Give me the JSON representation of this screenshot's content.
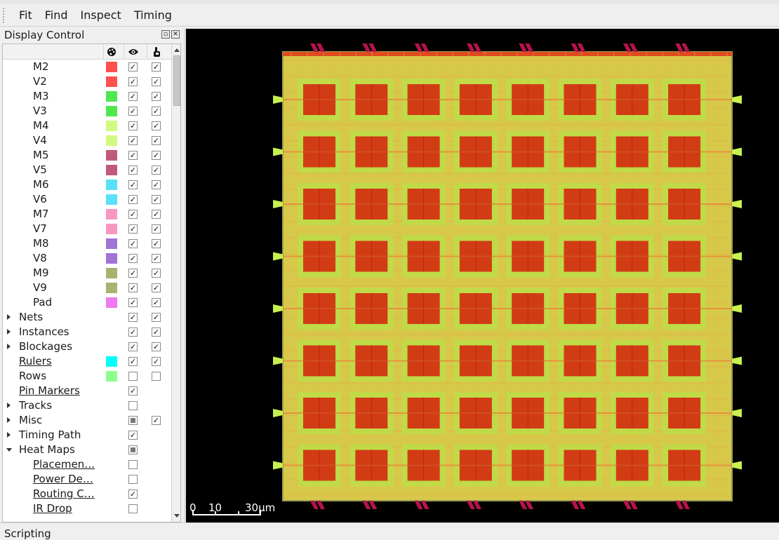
{
  "menu": [
    "Fit",
    "Find",
    "Inspect",
    "Timing"
  ],
  "dock": {
    "title": "Display Control",
    "float_icon": "float-icon",
    "close_icon": "close-icon",
    "columns": [
      "palette-icon",
      "eye-icon",
      "pointer-hand-icon"
    ],
    "rows": [
      {
        "label": "M2",
        "level": 2,
        "color": "#ff5050",
        "visible": true,
        "selectable": true
      },
      {
        "label": "V2",
        "level": 2,
        "color": "#ff5050",
        "visible": true,
        "selectable": true
      },
      {
        "label": "M3",
        "level": 2,
        "color": "#50e650",
        "visible": true,
        "selectable": true
      },
      {
        "label": "V3",
        "level": 2,
        "color": "#50e650",
        "visible": true,
        "selectable": true
      },
      {
        "label": "M4",
        "level": 2,
        "color": "#d2fa82",
        "visible": true,
        "selectable": true
      },
      {
        "label": "V4",
        "level": 2,
        "color": "#d2fa82",
        "visible": true,
        "selectable": true
      },
      {
        "label": "M5",
        "level": 2,
        "color": "#be5a7d",
        "visible": true,
        "selectable": true
      },
      {
        "label": "V5",
        "level": 2,
        "color": "#be5a7d",
        "visible": true,
        "selectable": true
      },
      {
        "label": "M6",
        "level": 2,
        "color": "#5ae1fa",
        "visible": true,
        "selectable": true
      },
      {
        "label": "V6",
        "level": 2,
        "color": "#5ae1fa",
        "visible": true,
        "selectable": true
      },
      {
        "label": "M7",
        "level": 2,
        "color": "#fa96c3",
        "visible": true,
        "selectable": true
      },
      {
        "label": "V7",
        "level": 2,
        "color": "#fa96c3",
        "visible": true,
        "selectable": true
      },
      {
        "label": "M8",
        "level": 2,
        "color": "#a073d7",
        "visible": true,
        "selectable": true
      },
      {
        "label": "V8",
        "level": 2,
        "color": "#a073d7",
        "visible": true,
        "selectable": true
      },
      {
        "label": "M9",
        "level": 2,
        "color": "#a5b46e",
        "visible": true,
        "selectable": true
      },
      {
        "label": "V9",
        "level": 2,
        "color": "#a5b46e",
        "visible": true,
        "selectable": true
      },
      {
        "label": "Pad",
        "level": 2,
        "color": "#f078f0",
        "visible": true,
        "selectable": true
      },
      {
        "label": "Nets",
        "level": 1,
        "expander": "collapsed",
        "visible": true,
        "selectable": true
      },
      {
        "label": "Instances",
        "level": 1,
        "expander": "collapsed",
        "visible": true,
        "selectable": true
      },
      {
        "label": "Blockages",
        "level": 1,
        "expander": "collapsed",
        "visible": true,
        "selectable": true
      },
      {
        "label": "Rulers",
        "level": 1,
        "link": true,
        "color": "#00ffff",
        "visible": true,
        "selectable": true
      },
      {
        "label": "Rows",
        "level": 1,
        "color": "#8cff8c",
        "visible": false,
        "selectable": false
      },
      {
        "label": "Pin Markers",
        "level": 1,
        "link": true,
        "visible": true
      },
      {
        "label": "Tracks",
        "level": 1,
        "expander": "collapsed",
        "visible": false
      },
      {
        "label": "Misc",
        "level": 1,
        "expander": "collapsed",
        "visible": "partial",
        "selectable": true
      },
      {
        "label": "Timing Path",
        "level": 1,
        "expander": "collapsed",
        "visible": true
      },
      {
        "label": "Heat Maps",
        "level": 1,
        "expander": "expanded",
        "visible": "partial"
      },
      {
        "label": "Placemen…",
        "level": 2,
        "link": true,
        "visible": false
      },
      {
        "label": "Power De…",
        "level": 2,
        "link": true,
        "visible": false
      },
      {
        "label": "Routing C…",
        "level": 2,
        "link": true,
        "visible": true
      },
      {
        "label": "IR Drop",
        "level": 2,
        "link": true,
        "visible": false
      }
    ]
  },
  "layout": {
    "die_color": "#d8c84a",
    "macro_color": "#d23c14",
    "pin_color": "#c8f050",
    "bump_color": "#b4144a",
    "grid_cols": 8,
    "grid_rows": 8
  },
  "scale": {
    "ticks": [
      "0",
      "10",
      "30μm"
    ]
  },
  "bottom": {
    "label": "Scripting"
  }
}
